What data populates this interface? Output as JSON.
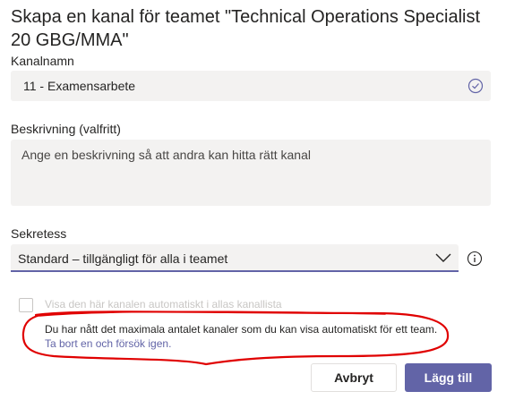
{
  "dialog": {
    "title": "Skapa en kanal för teamet \"Technical Operations Specialist 20 GBG/MMA\""
  },
  "channel_name": {
    "label": "Kanalnamn",
    "value": "11 - Examensarbete",
    "status_icon": "check-circle-icon"
  },
  "description": {
    "label": "Beskrivning (valfritt)",
    "placeholder": "Ange en beskrivning så att andra kan hitta rätt kanal"
  },
  "privacy": {
    "label": "Sekretess",
    "selected": "Standard – tillgängligt för alla i teamet",
    "chevron_icon": "chevron-down-icon",
    "info_icon": "info-icon"
  },
  "auto_show": {
    "checked": false,
    "label": "Visa den här kanalen automatiskt i allas kanallista"
  },
  "warning": {
    "text": "Du har nått det maximala antalet kanaler som du kan visa automatiskt för ett team.",
    "link": "Ta bort en och försök igen."
  },
  "annotation": {
    "color": "#e00000"
  },
  "buttons": {
    "cancel": "Avbryt",
    "add": "Lägg till"
  },
  "colors": {
    "accent": "#6264a7",
    "field_bg": "#f3f2f1"
  }
}
